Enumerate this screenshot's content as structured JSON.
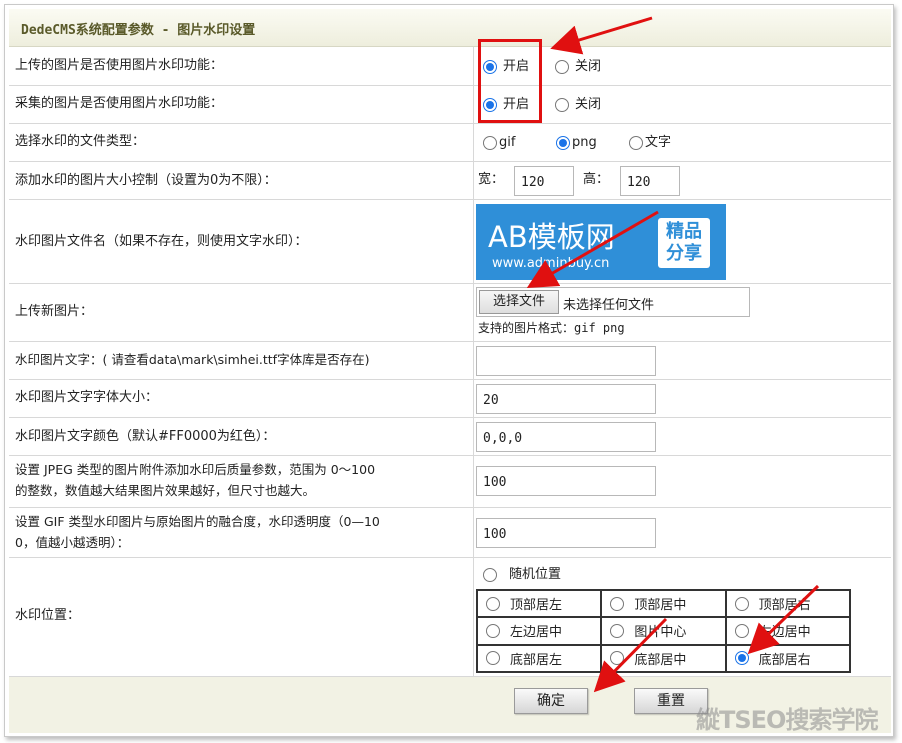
{
  "header": {
    "title": "DedeCMS系统配置参数 - 图片水印设置"
  },
  "rows": {
    "upload_watermark": {
      "label": "上传的图片是否使用图片水印功能：",
      "on": "开启",
      "off": "关闭",
      "value": "开启"
    },
    "collect_watermark": {
      "label": "采集的图片是否使用图片水印功能：",
      "on": "开启",
      "off": "关闭",
      "value": "开启"
    },
    "file_type": {
      "label": "选择水印的文件类型：",
      "options": [
        "gif",
        "png",
        "文字"
      ],
      "value": "png"
    },
    "size": {
      "label": "添加水印的图片大小控制（设置为0为不限）：",
      "width_label": "宽：",
      "width_value": "120",
      "height_label": "高：",
      "height_value": "120"
    },
    "image_file": {
      "label": "水印图片文件名（如果不存在，则使用文字水印）：",
      "logo_text": "AB模板网",
      "logo_url": "www.adminbuy.cn",
      "logo_badge_1": "精品",
      "logo_badge_2": "分享"
    },
    "upload_new": {
      "label": "上传新图片：",
      "button": "选择文件",
      "no_file": "未选择任何文件",
      "hint": "支持的图片格式：gif png"
    },
    "text": {
      "label": "水印图片文字：(  请查看data\\mark\\simhei.ttf字体库是否存在)",
      "value": ""
    },
    "font_size": {
      "label": "水印图片文字字体大小：",
      "value": "20"
    },
    "font_color": {
      "label": "水印图片文字颜色（默认#FF0000为红色）：",
      "value": "0,0,0"
    },
    "jpeg_quality": {
      "label_line1": "设置 JPEG 类型的图片附件添加水印后质量参数，范围为 0～100",
      "label_line2": "的整数，数值越大结果图片效果越好，但尺寸也越大。",
      "value": "100"
    },
    "gif_opacity": {
      "label_line1": "设置 GIF 类型水印图片与原始图片的融合度，水印透明度（0—10",
      "label_line2": "0，值越小越透明）：",
      "value": "100"
    },
    "position": {
      "label": "水印位置：",
      "random": "随机位置",
      "cells": [
        "顶部居左",
        "顶部居中",
        "顶部居右",
        "左边居中",
        "图片中心",
        "右边居中",
        "底部居左",
        "底部居中",
        "底部居右"
      ],
      "value": "底部居右"
    }
  },
  "buttons": {
    "submit": "确定",
    "reset": "重置"
  },
  "watermark": "縱TSEO搜索学院",
  "colors": {
    "accent": "#1a73e8",
    "annotation": "#e01010",
    "header_bg": "#eeeedd",
    "footer_bg": "#f2f2e4"
  }
}
